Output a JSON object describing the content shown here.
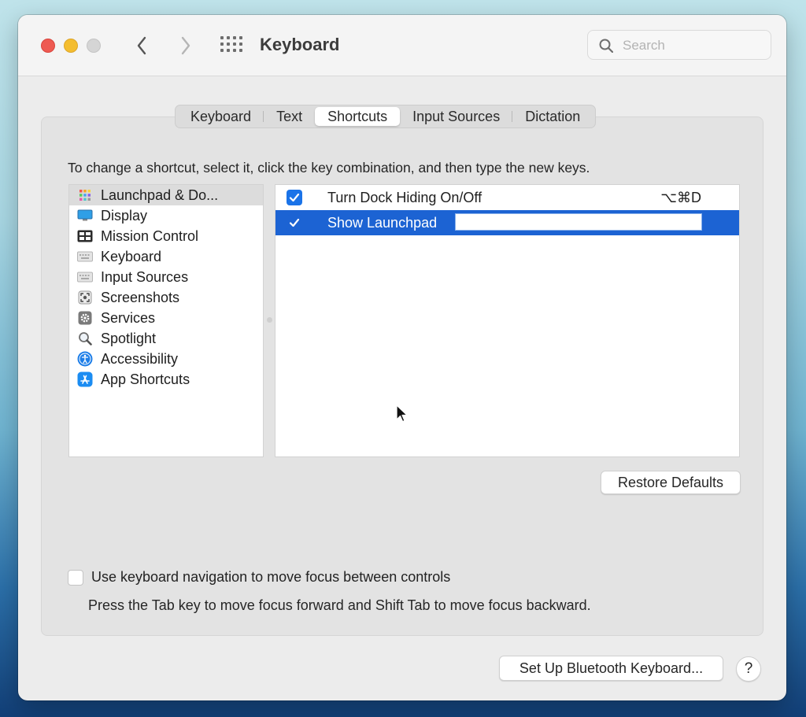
{
  "window": {
    "title": "Keyboard",
    "search_placeholder": "Search"
  },
  "toolbar": {
    "back_icon": "chevron-left-icon",
    "forward_icon": "chevron-right-icon",
    "grid_icon": "grid-icon"
  },
  "tabs": [
    {
      "label": "Keyboard",
      "active": false
    },
    {
      "label": "Text",
      "active": false
    },
    {
      "label": "Shortcuts",
      "active": true
    },
    {
      "label": "Input Sources",
      "active": false
    },
    {
      "label": "Dictation",
      "active": false
    }
  ],
  "instructions": "To change a shortcut, select it, click the key combination, and then type the new keys.",
  "categories": [
    {
      "label": "Launchpad & Do...",
      "icon": "launchpad-icon",
      "selected": true
    },
    {
      "label": "Display",
      "icon": "display-icon",
      "selected": false
    },
    {
      "label": "Mission Control",
      "icon": "mission-control-icon",
      "selected": false
    },
    {
      "label": "Keyboard",
      "icon": "keyboard-icon",
      "selected": false
    },
    {
      "label": "Input Sources",
      "icon": "keyboard-icon",
      "selected": false
    },
    {
      "label": "Screenshots",
      "icon": "screenshot-icon",
      "selected": false
    },
    {
      "label": "Services",
      "icon": "gear-icon",
      "selected": false
    },
    {
      "label": "Spotlight",
      "icon": "magnifier-icon",
      "selected": false
    },
    {
      "label": "Accessibility",
      "icon": "accessibility-icon",
      "selected": false
    },
    {
      "label": "App Shortcuts",
      "icon": "app-store-icon",
      "selected": false
    }
  ],
  "shortcuts": [
    {
      "label": "Turn Dock Hiding On/Off",
      "keys": "⌥⌘D",
      "checked": true,
      "selected": false
    },
    {
      "label": "Show Launchpad",
      "keys": "",
      "checked": true,
      "selected": true,
      "editing": true
    }
  ],
  "buttons": {
    "restore_defaults": "Restore Defaults",
    "bluetooth": "Set Up Bluetooth Keyboard...",
    "help": "?"
  },
  "keyboard_navigation": {
    "label": "Use keyboard navigation to move focus between controls",
    "checked": false,
    "hint": "Press the Tab key to move focus forward and Shift Tab to move focus backward."
  },
  "colors": {
    "accent": "#1c63d3",
    "checkbox": "#1a73e8",
    "close": "#ee5a52",
    "minimize": "#f4bd2f",
    "zoom_disabled": "#d5d5d5"
  }
}
